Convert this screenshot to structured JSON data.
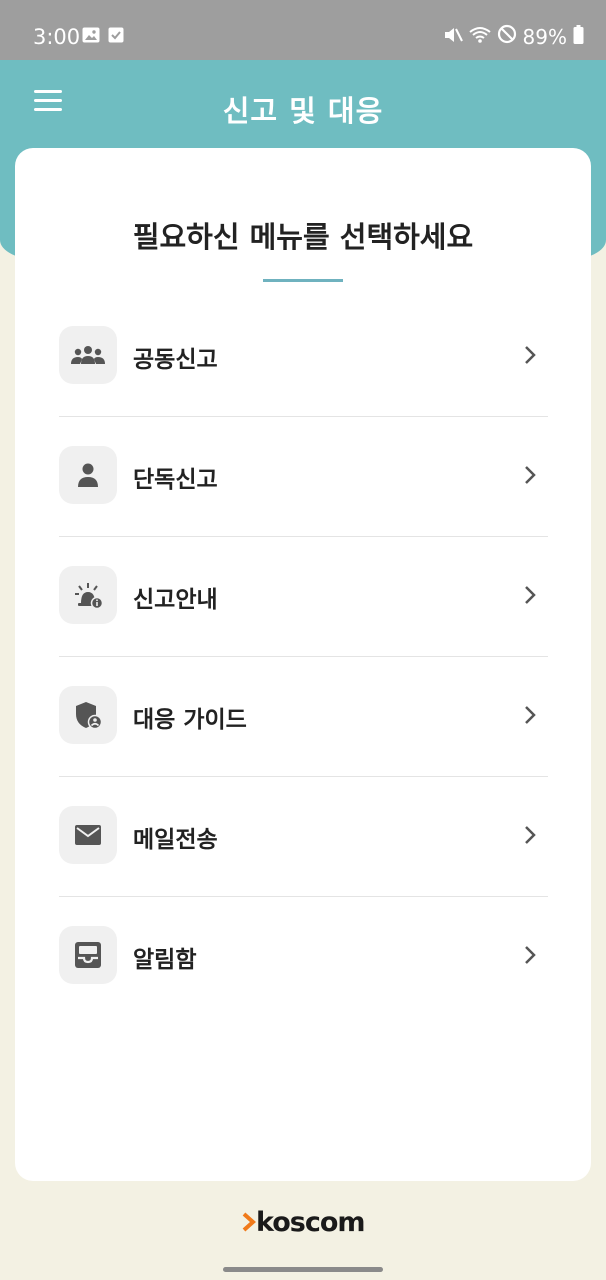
{
  "status_bar": {
    "time": "3:00",
    "battery": "89%",
    "icons": [
      "gallery-icon",
      "check-icon",
      "mute-icon",
      "wifi-icon",
      "no-disturb-icon",
      "battery-icon"
    ]
  },
  "header": {
    "title": "신고 및 대응"
  },
  "card": {
    "title": "필요하신 메뉴를 선택하세요"
  },
  "menu": [
    {
      "label": "공동신고",
      "icon": "group-icon"
    },
    {
      "label": "단독신고",
      "icon": "person-icon"
    },
    {
      "label": "신고안내",
      "icon": "siren-info-icon"
    },
    {
      "label": "대응 가이드",
      "icon": "shield-user-icon"
    },
    {
      "label": "메일전송",
      "icon": "mail-icon"
    },
    {
      "label": "알림함",
      "icon": "inbox-icon"
    }
  ],
  "footer": {
    "logo_text": "koscom"
  },
  "colors": {
    "header_bg": "#6fbdc1",
    "page_bg": "#f3f1e3",
    "accent_line": "#6fb2bf",
    "logo_chevron": "#f07a1a"
  }
}
